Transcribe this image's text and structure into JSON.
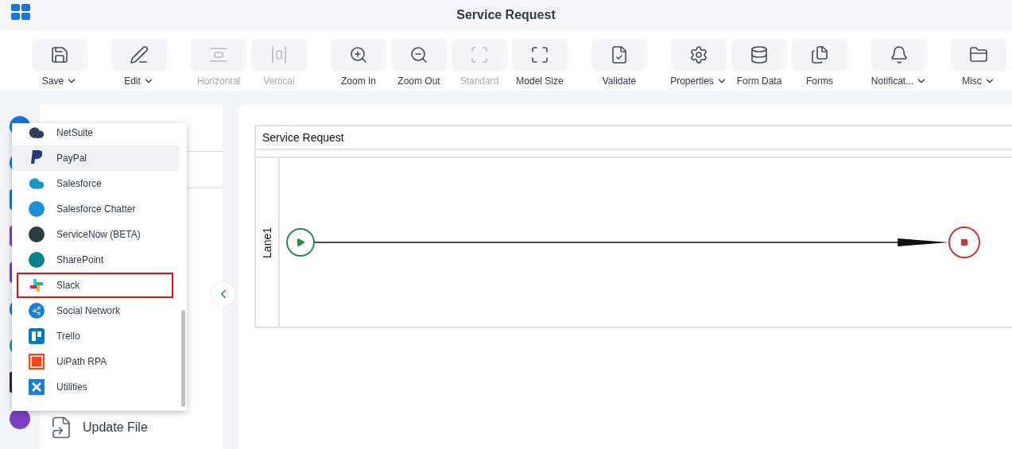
{
  "app": {
    "title": "Service Request"
  },
  "toolbar": {
    "groups": [
      {
        "items": [
          {
            "label": "Save",
            "dropdown": true,
            "disabled": false
          }
        ]
      },
      {
        "items": [
          {
            "label": "Edit",
            "dropdown": true,
            "disabled": false
          }
        ]
      },
      {
        "items": [
          {
            "label": "Horizontal",
            "dropdown": false,
            "disabled": true
          },
          {
            "label": "Vertical",
            "dropdown": false,
            "disabled": true
          }
        ]
      },
      {
        "items": [
          {
            "label": "Zoom In",
            "dropdown": false,
            "disabled": false
          },
          {
            "label": "Zoom Out",
            "dropdown": false,
            "disabled": false
          },
          {
            "label": "Standard",
            "dropdown": false,
            "disabled": true
          },
          {
            "label": "Model Size",
            "dropdown": false,
            "disabled": false
          }
        ]
      },
      {
        "items": [
          {
            "label": "Validate",
            "dropdown": false,
            "disabled": false
          }
        ]
      },
      {
        "items": [
          {
            "label": "Properties",
            "dropdown": true,
            "disabled": false
          },
          {
            "label": "Form Data",
            "dropdown": false,
            "disabled": false
          },
          {
            "label": "Forms",
            "dropdown": false,
            "disabled": false
          }
        ]
      },
      {
        "items": [
          {
            "label": "Notificat...",
            "dropdown": true,
            "disabled": false
          }
        ]
      },
      {
        "items": [
          {
            "label": "Misc",
            "dropdown": true,
            "disabled": false
          }
        ]
      }
    ]
  },
  "palette": {
    "items": [
      {
        "label": "NetSuite",
        "color": "#2f3f5c",
        "selected": false,
        "highlighted": false
      },
      {
        "label": "PayPal",
        "color": "#253b80",
        "selected": true,
        "highlighted": false
      },
      {
        "label": "Salesforce",
        "color": "#1798c1",
        "selected": false,
        "highlighted": false
      },
      {
        "label": "Salesforce Chatter",
        "color": "#1b8fd8",
        "selected": false,
        "highlighted": false
      },
      {
        "label": "ServiceNow (BETA)",
        "color": "#293e40",
        "selected": false,
        "highlighted": false
      },
      {
        "label": "SharePoint",
        "color": "#038387",
        "selected": false,
        "highlighted": false
      },
      {
        "label": "Slack",
        "color": "#e01e5a",
        "selected": false,
        "highlighted": true
      },
      {
        "label": "Social Network",
        "color": "#1a7fd8",
        "selected": false,
        "highlighted": false
      },
      {
        "label": "Trello",
        "color": "#0079bf",
        "selected": false,
        "highlighted": false
      },
      {
        "label": "UiPath RPA",
        "color": "#fa4616",
        "selected": false,
        "highlighted": false
      },
      {
        "label": "Utilities",
        "color": "#1a7fd8",
        "selected": false,
        "highlighted": false
      }
    ]
  },
  "side_panel": {
    "items": [
      {
        "label": "Update File"
      }
    ]
  },
  "diagram": {
    "pool_title": "Service Request",
    "lanes": [
      {
        "label": "Lane1"
      }
    ]
  }
}
